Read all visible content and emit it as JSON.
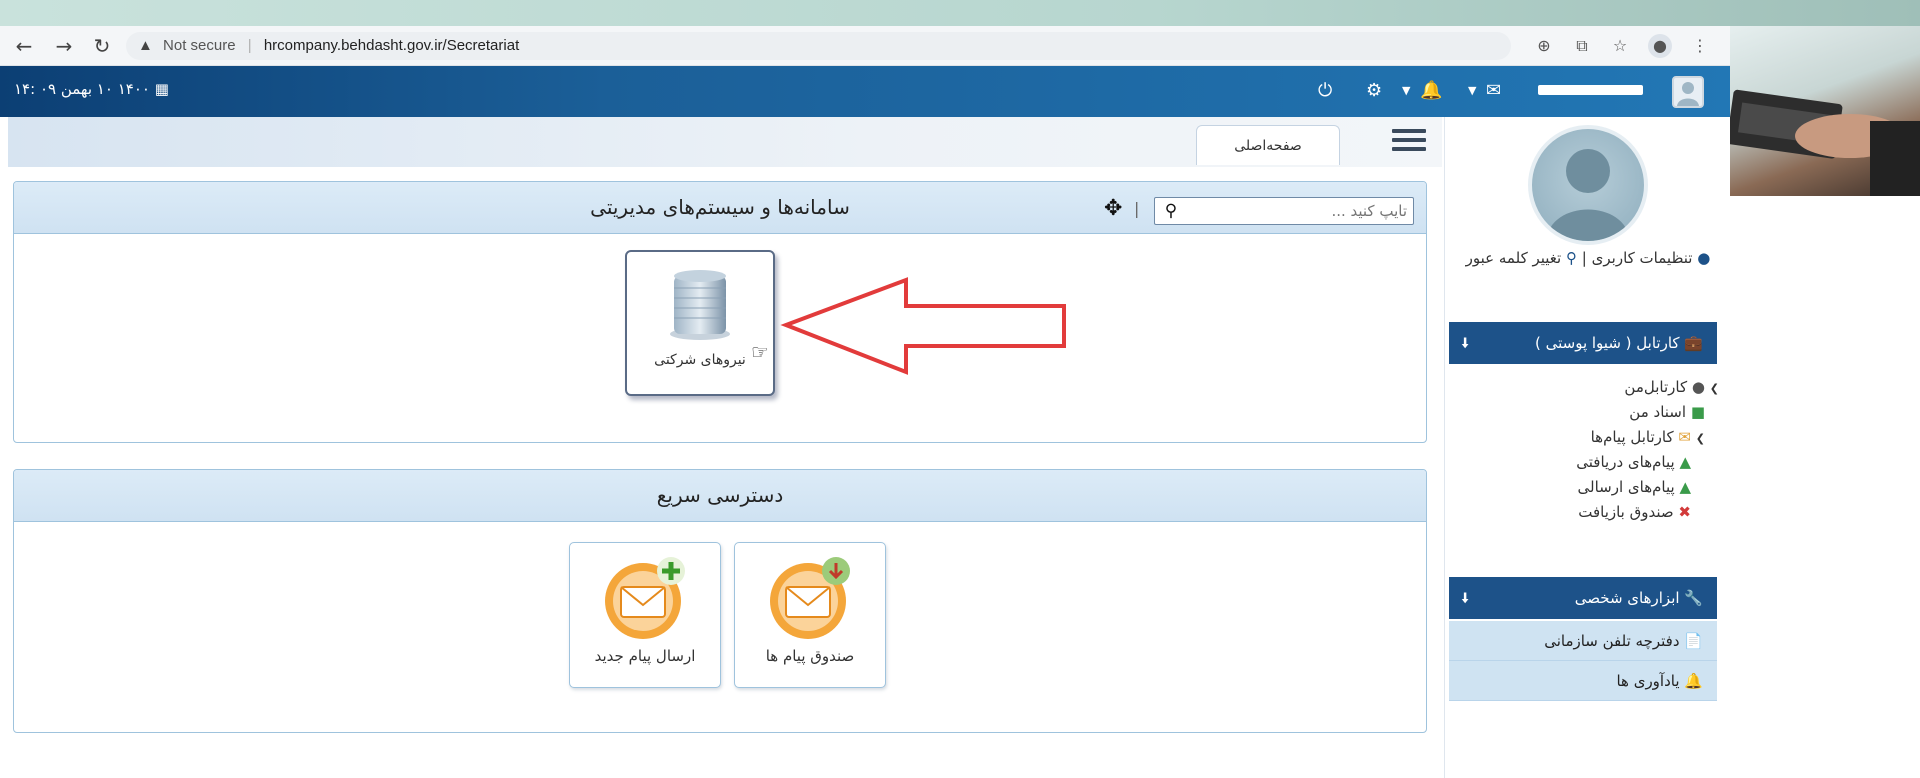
{
  "browser": {
    "back_icon": "arrow-left-icon",
    "forward_icon": "arrow-right-icon",
    "reload_icon": "reload-icon",
    "security_label": "Not secure",
    "url": "hrcompany.behdasht.gov.ir/Secretariat"
  },
  "header": {
    "datetime": "۱۴۰۰ ۱۰ بهمن ۰۹ :۱۴",
    "colors": {
      "header_start": "#0c3f74",
      "header_end": "#2277b5",
      "sidebar_panel": "#1d5289",
      "tool_row_bg": "#cfe3f2"
    }
  },
  "sidebar": {
    "user_links": {
      "settings": "تنظیمات کاربری",
      "separator": "|",
      "change_password": "تغییر کلمه عبور"
    },
    "cartable_title": "کارتابل ( شیوا پوستی )",
    "tree": [
      {
        "label": "کارتابل‌من"
      },
      {
        "label": "اسناد من"
      },
      {
        "label": "کارتابل پیام‌ها"
      },
      {
        "label": "پیام‌های دریافتی"
      },
      {
        "label": "پیام‌های ارسالی"
      },
      {
        "label": "صندوق بازیافت"
      }
    ],
    "tools_title": "ابزارهای شخصی",
    "tools": [
      {
        "label": "دفترچه تلفن سازمانی"
      },
      {
        "label": "یادآوری ها"
      }
    ]
  },
  "main": {
    "home_tab": "صفحه‌اصلی",
    "systems": {
      "title": "سامانه‌ها و سیستم‌های مدیریتی",
      "search_placeholder": "تایپ کنید ...",
      "tiles": [
        {
          "label": "نیروهای شرکتی",
          "icon": "building-icon"
        }
      ]
    },
    "quick_access": {
      "title": "دسترسی سریع",
      "tiles": [
        {
          "label": "صندوق پیام ها",
          "icon": "inbox-mail-icon"
        },
        {
          "label": "ارسال پیام جدید",
          "icon": "new-mail-icon"
        }
      ]
    }
  }
}
